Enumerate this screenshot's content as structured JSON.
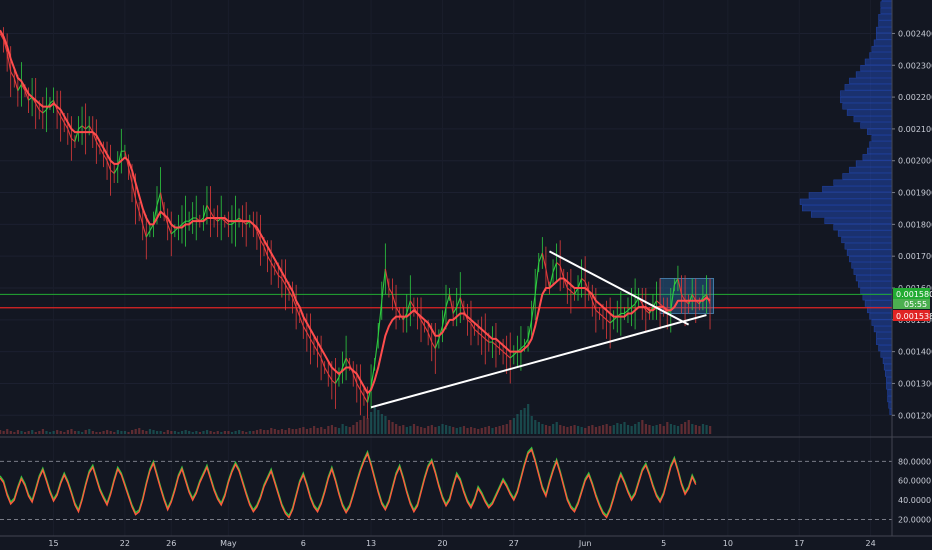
{
  "chart_data": {
    "type": "line",
    "price_axis": {
      "ticks": [
        "0.002400",
        "0.002300",
        "0.002200",
        "0.002100",
        "0.002000",
        "0.001900",
        "0.001800",
        "0.001700",
        "0.001600",
        "0.001500",
        "0.001400",
        "0.001300",
        "0.001200"
      ],
      "ylim": [
        0.00116,
        0.00248
      ]
    },
    "rsi_axis": {
      "ticks": [
        "80.0000",
        "60.0000",
        "40.0000",
        "20.0000"
      ],
      "ylim": [
        5,
        100
      ],
      "bands": [
        80,
        20
      ]
    },
    "x_axis": {
      "tick_labels": [
        "15",
        "22",
        "26",
        "May",
        "6",
        "13",
        "20",
        "27",
        "Jun",
        "5",
        "10",
        "17",
        "24"
      ],
      "tick_idx": [
        15,
        35,
        48,
        64,
        85,
        104,
        124,
        144,
        164,
        186,
        204,
        224,
        244
      ]
    },
    "badges": {
      "green_level": "0.001580",
      "current_time": "05:55",
      "red_level": "0.001538"
    },
    "levels": {
      "green": 0.00158,
      "red": 0.001538
    },
    "price_series": {
      "name": "",
      "start_idx": 0,
      "step": 1,
      "values": [
        0.0024,
        0.00238,
        0.00234,
        0.00228,
        0.00226,
        0.00222,
        0.00224,
        0.00222,
        0.00219,
        0.0022,
        0.00218,
        0.00216,
        0.00215,
        0.00216,
        0.00218,
        0.00219,
        0.00216,
        0.00214,
        0.00212,
        0.0021,
        0.00207,
        0.00206,
        0.0021,
        0.00211,
        0.0021,
        0.00211,
        0.00209,
        0.00206,
        0.00204,
        0.00202,
        0.002,
        0.00197,
        0.00196,
        0.00198,
        0.00203,
        0.00203,
        0.00198,
        0.00193,
        0.00188,
        0.00184,
        0.0018,
        0.00176,
        0.00178,
        0.0018,
        0.00186,
        0.0019,
        0.00184,
        0.0018,
        0.00177,
        0.00178,
        0.00179,
        0.0018,
        0.00181,
        0.00181,
        0.00182,
        0.00182,
        0.00181,
        0.00182,
        0.00186,
        0.00184,
        0.00182,
        0.00181,
        0.00182,
        0.00181,
        0.0018,
        0.0018,
        0.00181,
        0.00182,
        0.00181,
        0.0018,
        0.00181,
        0.0018,
        0.00178,
        0.00175,
        0.00173,
        0.0017,
        0.00168,
        0.00166,
        0.00164,
        0.00163,
        0.00161,
        0.00159,
        0.00157,
        0.00154,
        0.00151,
        0.00148,
        0.00146,
        0.00144,
        0.00142,
        0.0014,
        0.00138,
        0.00135,
        0.00133,
        0.00131,
        0.0013,
        0.00132,
        0.00135,
        0.00138,
        0.00136,
        0.00133,
        0.0013,
        0.00128,
        0.00126,
        0.00124,
        0.00129,
        0.00136,
        0.00145,
        0.00156,
        0.00166,
        0.0016,
        0.00158,
        0.00154,
        0.00152,
        0.0015,
        0.00152,
        0.00156,
        0.00154,
        0.00152,
        0.0015,
        0.00148,
        0.00146,
        0.00143,
        0.00141,
        0.00144,
        0.00148,
        0.00154,
        0.00158,
        0.00152,
        0.00154,
        0.00157,
        0.00153,
        0.0015,
        0.00149,
        0.00147,
        0.00146,
        0.00145,
        0.00144,
        0.00143,
        0.00143,
        0.00142,
        0.00141,
        0.0014,
        0.00139,
        0.00138,
        0.00139,
        0.0014,
        0.00141,
        0.00142,
        0.00144,
        0.0015,
        0.00158,
        0.00168,
        0.00171,
        0.00166,
        0.0016,
        0.00165,
        0.00168,
        0.00167,
        0.00163,
        0.0016,
        0.00159,
        0.00158,
        0.0016,
        0.00163,
        0.00162,
        0.00159,
        0.00156,
        0.00153,
        0.00152,
        0.00151,
        0.0015,
        0.00149,
        0.0015,
        0.00151,
        0.00152,
        0.00152,
        0.00153,
        0.00154,
        0.00155,
        0.00157,
        0.00155,
        0.00153,
        0.00152,
        0.00154,
        0.00156,
        0.00155,
        0.00154,
        0.00152,
        0.00153,
        0.00161,
        0.00163,
        0.00158,
        0.00156,
        0.00155,
        0.00158,
        0.00156,
        0.00155,
        0.00157,
        0.00158,
        0.00155
      ]
    },
    "ema_series": {
      "name": "",
      "start_idx": 0,
      "step": 1,
      "values": [
        0.00241,
        0.00239,
        0.00236,
        0.00232,
        0.00229,
        0.00226,
        0.00225,
        0.00223,
        0.00221,
        0.0022,
        0.00219,
        0.00218,
        0.00217,
        0.00217,
        0.00217,
        0.00218,
        0.00217,
        0.00216,
        0.00214,
        0.00212,
        0.0021,
        0.00209,
        0.00209,
        0.00209,
        0.00209,
        0.00209,
        0.00209,
        0.00208,
        0.00206,
        0.00204,
        0.00202,
        0.002,
        0.00199,
        0.00199,
        0.002,
        0.00201,
        0.002,
        0.00197,
        0.00193,
        0.00189,
        0.00185,
        0.00182,
        0.0018,
        0.0018,
        0.00182,
        0.00184,
        0.00183,
        0.00182,
        0.0018,
        0.00179,
        0.00179,
        0.00179,
        0.0018,
        0.0018,
        0.00181,
        0.00181,
        0.00181,
        0.00181,
        0.00182,
        0.00182,
        0.00182,
        0.00182,
        0.00182,
        0.00182,
        0.00181,
        0.00181,
        0.00181,
        0.00181,
        0.00181,
        0.00181,
        0.00181,
        0.0018,
        0.00179,
        0.00177,
        0.00175,
        0.00173,
        0.00171,
        0.00169,
        0.00167,
        0.00165,
        0.00163,
        0.00161,
        0.00159,
        0.00156,
        0.00154,
        0.00151,
        0.00149,
        0.00147,
        0.00145,
        0.00143,
        0.00141,
        0.00139,
        0.00137,
        0.00135,
        0.00134,
        0.00133,
        0.00134,
        0.00135,
        0.00135,
        0.00134,
        0.00133,
        0.00131,
        0.00129,
        0.00127,
        0.00128,
        0.00131,
        0.00135,
        0.0014,
        0.00145,
        0.00148,
        0.0015,
        0.00151,
        0.00151,
        0.00151,
        0.00151,
        0.00152,
        0.00153,
        0.00152,
        0.00151,
        0.0015,
        0.00149,
        0.00147,
        0.00145,
        0.00145,
        0.00146,
        0.00148,
        0.0015,
        0.0015,
        0.00151,
        0.00152,
        0.00152,
        0.00151,
        0.0015,
        0.00149,
        0.00148,
        0.00147,
        0.00146,
        0.00145,
        0.00144,
        0.00144,
        0.00143,
        0.00142,
        0.00141,
        0.0014,
        0.0014,
        0.0014,
        0.0014,
        0.00141,
        0.00142,
        0.00144,
        0.00148,
        0.00153,
        0.00158,
        0.0016,
        0.0016,
        0.00161,
        0.00162,
        0.00163,
        0.00163,
        0.00162,
        0.00161,
        0.0016,
        0.0016,
        0.0016,
        0.0016,
        0.00159,
        0.00158,
        0.00156,
        0.00155,
        0.00154,
        0.00153,
        0.00152,
        0.00151,
        0.00151,
        0.00151,
        0.00151,
        0.00152,
        0.00152,
        0.00153,
        0.00154,
        0.00154,
        0.00154,
        0.00153,
        0.00153,
        0.00154,
        0.00154,
        0.00154,
        0.00153,
        0.00153,
        0.00154,
        0.00156,
        0.00156,
        0.00156,
        0.00156,
        0.00156,
        0.00156,
        0.00156,
        0.00156,
        0.00157,
        0.00156
      ]
    },
    "rsi_series": {
      "name": "",
      "start_idx": 0,
      "step": 1,
      "values": [
        63,
        58,
        45,
        36,
        40,
        52,
        62,
        55,
        44,
        38,
        50,
        63,
        71,
        60,
        48,
        39,
        45,
        57,
        66,
        58,
        47,
        35,
        28,
        40,
        55,
        68,
        74,
        62,
        50,
        42,
        35,
        46,
        60,
        72,
        66,
        55,
        44,
        33,
        25,
        28,
        40,
        56,
        70,
        78,
        65,
        52,
        40,
        30,
        38,
        50,
        64,
        72,
        60,
        48,
        40,
        47,
        58,
        66,
        74,
        62,
        50,
        41,
        35,
        44,
        58,
        69,
        77,
        70,
        58,
        46,
        35,
        28,
        33,
        42,
        54,
        62,
        70,
        58,
        46,
        34,
        26,
        22,
        30,
        44,
        58,
        66,
        55,
        42,
        33,
        28,
        36,
        48,
        62,
        72,
        60,
        46,
        34,
        27,
        33,
        45,
        58,
        70,
        80,
        88,
        76,
        62,
        48,
        36,
        30,
        38,
        52,
        66,
        74,
        62,
        48,
        36,
        28,
        34,
        48,
        62,
        74,
        80,
        68,
        54,
        42,
        34,
        40,
        54,
        66,
        60,
        48,
        38,
        32,
        40,
        52,
        46,
        38,
        32,
        36,
        44,
        52,
        60,
        54,
        46,
        40,
        48,
        62,
        76,
        88,
        92,
        80,
        66,
        52,
        44,
        58,
        70,
        80,
        68,
        54,
        40,
        32,
        28,
        36,
        48,
        60,
        66,
        56,
        44,
        34,
        26,
        22,
        30,
        42,
        56,
        66,
        58,
        48,
        40,
        46,
        58,
        70,
        76,
        66,
        54,
        44,
        38,
        46,
        60,
        74,
        82,
        70,
        56,
        46,
        52,
        64,
        56
      ]
    },
    "volume_series": {
      "name": "",
      "values": [
        4,
        3,
        5,
        3,
        2,
        4,
        3,
        2,
        3,
        4,
        2,
        3,
        5,
        3,
        2,
        3,
        4,
        3,
        2,
        4,
        5,
        3,
        3,
        2,
        4,
        5,
        3,
        2,
        2,
        3,
        4,
        3,
        2,
        4,
        3,
        3,
        2,
        4,
        5,
        6,
        4,
        3,
        5,
        4,
        3,
        3,
        2,
        4,
        3,
        3,
        2,
        3,
        4,
        3,
        2,
        3,
        2,
        3,
        4,
        3,
        2,
        3,
        2,
        3,
        3,
        2,
        3,
        4,
        3,
        2,
        3,
        3,
        4,
        5,
        4,
        4,
        6,
        5,
        4,
        5,
        4,
        6,
        5,
        5,
        6,
        7,
        5,
        6,
        8,
        6,
        7,
        5,
        8,
        9,
        7,
        6,
        10,
        8,
        7,
        9,
        12,
        14,
        18,
        16,
        22,
        28,
        24,
        20,
        18,
        14,
        12,
        10,
        8,
        9,
        7,
        8,
        10,
        8,
        7,
        6,
        8,
        9,
        7,
        8,
        10,
        9,
        8,
        7,
        6,
        7,
        8,
        6,
        7,
        6,
        5,
        6,
        7,
        8,
        6,
        7,
        8,
        9,
        10,
        14,
        16,
        20,
        24,
        26,
        30,
        18,
        14,
        12,
        10,
        9,
        8,
        10,
        12,
        9,
        8,
        7,
        8,
        9,
        8,
        7,
        6,
        8,
        9,
        7,
        8,
        9,
        10,
        8,
        9,
        11,
        10,
        12,
        9,
        8,
        10,
        12,
        14,
        10,
        9,
        8,
        9,
        10,
        8,
        12,
        10,
        9,
        8,
        10,
        12,
        14,
        10,
        9,
        8,
        10,
        9,
        8
      ]
    },
    "volume_profile": {
      "price_start": 0.0012,
      "price_step": 2e-05,
      "values": [
        2,
        3,
        4,
        4,
        5,
        5,
        6,
        7,
        8,
        10,
        12,
        14,
        14,
        16,
        18,
        20,
        22,
        24,
        26,
        28,
        30,
        32,
        34,
        36,
        38,
        40,
        42,
        45,
        48,
        52,
        60,
        72,
        80,
        82,
        74,
        62,
        52,
        44,
        38,
        32,
        26,
        22,
        20,
        18,
        22,
        28,
        34,
        40,
        44,
        46,
        46,
        42,
        38,
        32,
        28,
        24,
        20,
        18,
        16,
        14,
        14,
        12,
        12,
        10,
        10,
        9,
        8,
        8,
        7,
        6,
        6,
        5,
        5,
        4,
        4,
        3,
        3,
        3,
        2,
        2,
        2,
        2,
        2,
        2,
        3,
        2,
        2,
        2
      ]
    },
    "drawings": {
      "rising_line": {
        "from": [
          104,
          0.001225
        ],
        "to": [
          198,
          0.001515
        ]
      },
      "falling_line": {
        "from": [
          154,
          0.001715
        ],
        "to": [
          193,
          0.001485
        ]
      },
      "box": {
        "from": [
          185,
          0.00152
        ],
        "to": [
          200,
          0.00163
        ]
      }
    }
  }
}
